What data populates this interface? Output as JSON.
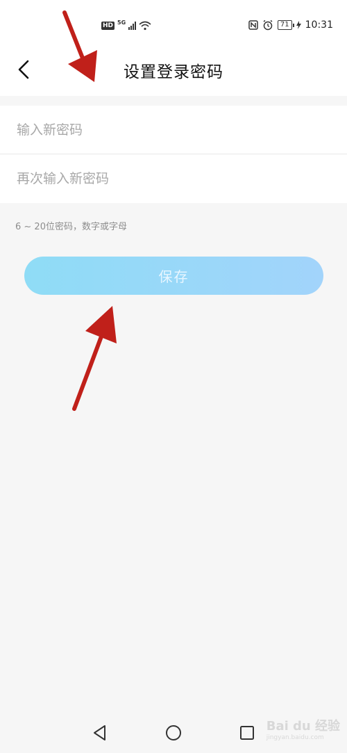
{
  "status_bar": {
    "hd": "HD",
    "network": "5G",
    "battery": "71",
    "time": "10:31"
  },
  "header": {
    "title": "设置登录密码"
  },
  "form": {
    "new_password_placeholder": "输入新密码",
    "confirm_password_placeholder": "再次输入新密码",
    "hint": "6 ~ 20位密码，数字或字母"
  },
  "save_button": {
    "label": "保存"
  },
  "watermark": {
    "brand": "Bai du 经验",
    "url": "jingyan.baidu.com"
  },
  "colors": {
    "button_start": "#8fdcf6",
    "button_end": "#a2d4fb",
    "annotation_arrow": "#c0201a"
  }
}
